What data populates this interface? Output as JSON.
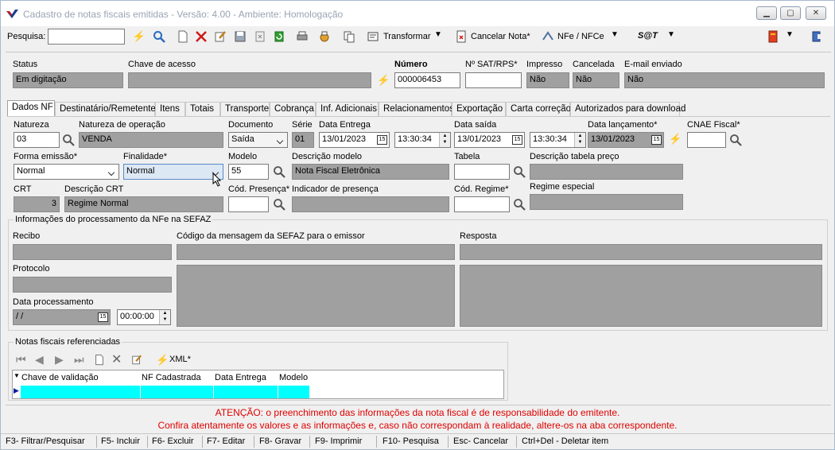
{
  "window": {
    "title": "Cadastro de notas fiscais emitidas - Versão: 4.00 - Ambiente: Homologação"
  },
  "toolbar": {
    "search_label": "Pesquisa:",
    "search_value": "",
    "transformar": "Transformar",
    "cancelar": "Cancelar Nota*",
    "nfe": "NFe / NFCe",
    "sat": "S@T"
  },
  "header": {
    "status_label": "Status",
    "status_value": "Em digitação",
    "chave_label": "Chave de acesso",
    "chave_value": "",
    "numero_label": "Número",
    "numero_value": "000006453",
    "sat_label": "Nº SAT/RPS*",
    "sat_value": "",
    "impresso_label": "Impresso",
    "impresso_value": "Não",
    "cancelada_label": "Cancelada",
    "cancelada_value": "Não",
    "email_label": "E-mail enviado",
    "email_value": "Não"
  },
  "tabs": [
    "Dados NF",
    "Destinatário/Remetente",
    "Itens",
    "Totais",
    "Transporte",
    "Cobrança",
    "Inf. Adicionais",
    "Relacionamentos",
    "Exportação",
    "Carta correção",
    "Autorizados para download"
  ],
  "form": {
    "natureza_label": "Natureza",
    "natureza_value": "03",
    "natop_label": "Natureza de operação",
    "natop_value": "VENDA",
    "documento_label": "Documento",
    "documento_value": "Saída",
    "serie_label": "Série",
    "serie_value": "01",
    "dtentrega_label": "Data Entrega",
    "dtentrega_value": "13/01/2023",
    "hrentrega_value": "13:30:34",
    "dtsaida_label": "Data saída",
    "dtsaida_value": "13/01/2023",
    "hrsaida_value": "13:30:34",
    "dtlanc_label": "Data lançamento*",
    "dtlanc_value": "13/01/2023",
    "cnae_label": "CNAE Fiscal*",
    "cnae_value": "",
    "forma_label": "Forma emissão*",
    "forma_value": "Normal",
    "finalidade_label": "Finalidade*",
    "finalidade_value": "Normal",
    "modelo_label": "Modelo",
    "modelo_value": "55",
    "descmodelo_label": "Descrição modelo",
    "descmodelo_value": "Nota Fiscal Eletrônica",
    "tabela_label": "Tabela",
    "tabela_value": "",
    "desctabela_label": "Descrição tabela preço",
    "desctabela_value": "",
    "crt_label": "CRT",
    "crt_value": "3",
    "desccrt_label": "Descrição CRT",
    "desccrt_value": "Regime Normal",
    "codpres_label": "Cód. Presença*",
    "codpres_value": "",
    "indpres_label": "Indicador de presença",
    "indpres_value": "",
    "codreg_label": "Cód. Regime*",
    "codreg_value": "",
    "regesp_label": "Regime especial",
    "regesp_value": ""
  },
  "sefaz": {
    "group_label": "Informações do processamento da NFe na SEFAZ",
    "recibo_label": "Recibo",
    "codmsg_label": "Código da mensagem da SEFAZ para o emissor",
    "resposta_label": "Resposta",
    "protocolo_label": "Protocolo",
    "dtproc_label": "Data processamento",
    "dtproc_value": "  /  /",
    "hrproc_value": "00:00:00"
  },
  "referenced": {
    "group_label": "Notas fiscais referenciadas",
    "xml_label": "XML*",
    "columns": [
      "Chave de validação",
      "NF Cadastrada",
      "Data Entrega",
      "Modelo"
    ]
  },
  "warning": {
    "line1": "ATENÇÃO: o preenchimento das informações da nota fiscal é de responsabilidade do emitente.",
    "line2": "Confira atentamente os valores e as informações e, caso não correspondam à realidade, altere-os na aba correspondente."
  },
  "statusbar": [
    "F3- Filtrar/Pesquisar",
    "F5- Incluir",
    "F6- Excluir",
    "F7- Editar",
    "F8- Gravar",
    "F9- Imprimir",
    "F10- Pesquisa",
    "Esc- Cancelar",
    "Ctrl+Del - Deletar item"
  ],
  "colors": {
    "readonly": "#a0a0a0",
    "grid_highlight": "#00ffff",
    "warning": "#e00000"
  }
}
